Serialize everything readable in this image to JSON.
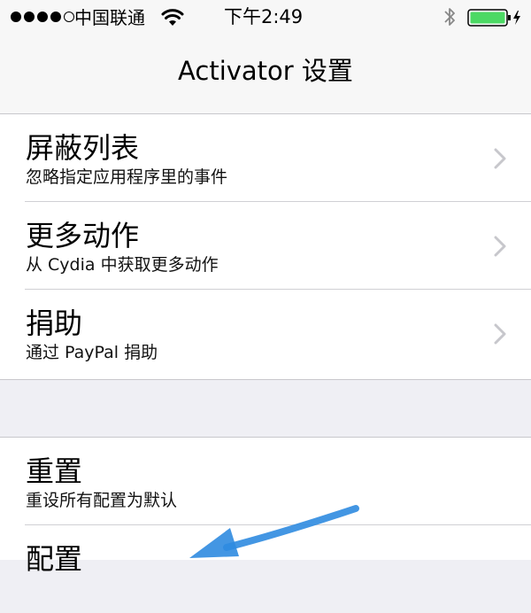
{
  "status_bar": {
    "carrier": "中国联通",
    "time": "下午2:49",
    "signal_filled": 4,
    "signal_total": 5,
    "battery_level_percent": 100,
    "battery_color": "#4cd964"
  },
  "nav": {
    "title": "Activator 设置"
  },
  "groups": [
    {
      "rows": [
        {
          "title": "屏蔽列表",
          "subtitle": "忽略指定应用程序里的事件",
          "chevron": true
        },
        {
          "title": "更多动作",
          "subtitle": "从 Cydia 中获取更多动作",
          "chevron": true
        },
        {
          "title": "捐助",
          "subtitle": "通过 PayPal 捐助",
          "chevron": true
        }
      ]
    },
    {
      "rows": [
        {
          "title": "重置",
          "subtitle": "重设所有配置为默认"
        },
        {
          "title": "配置"
        }
      ]
    }
  ],
  "annotation": {
    "arrow_color": "#2f8be0"
  },
  "colors": {
    "background": "#efeff4",
    "separator": "#c8c7cc",
    "chevron": "#c7c7cc"
  }
}
